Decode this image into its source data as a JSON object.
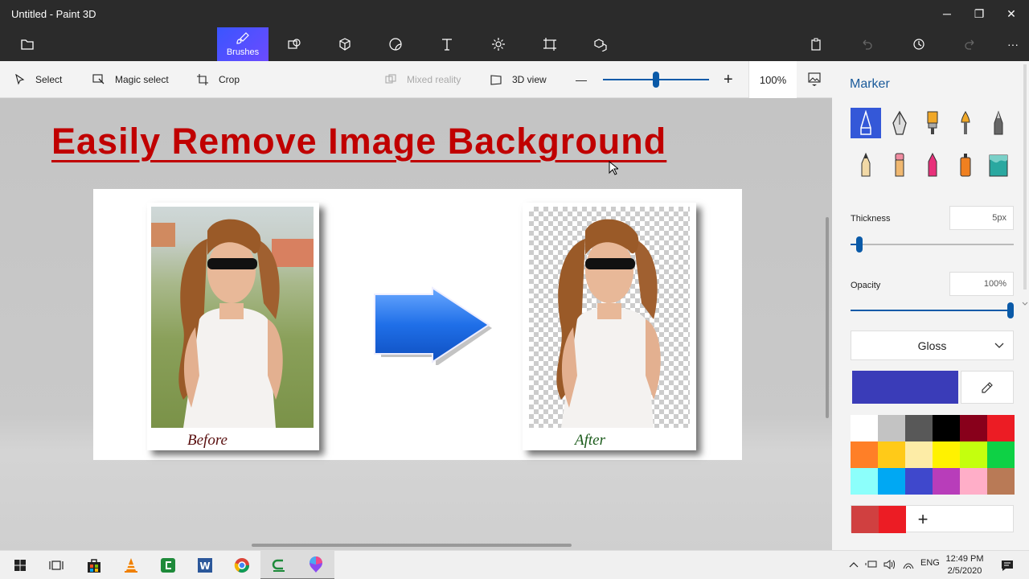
{
  "window": {
    "title": "Untitled - Paint 3D",
    "minimize": "─",
    "maximize": "❐",
    "close": "✕"
  },
  "toolbar": {
    "tools": [
      {
        "name": "brushes",
        "label": "Brushes",
        "active": true
      },
      {
        "name": "2d-shapes",
        "label": "",
        "active": false
      },
      {
        "name": "3d-shapes",
        "label": "",
        "active": false
      },
      {
        "name": "stickers",
        "label": "",
        "active": false
      },
      {
        "name": "text",
        "label": "",
        "active": false
      },
      {
        "name": "effects",
        "label": "",
        "active": false
      },
      {
        "name": "canvas",
        "label": "",
        "active": false
      },
      {
        "name": "3d-library",
        "label": "",
        "active": false
      }
    ],
    "more": "···"
  },
  "subtoolbar": {
    "select": "Select",
    "magic_select": "Magic select",
    "crop": "Crop",
    "mixed_reality": "Mixed reality",
    "view_3d": "3D view",
    "zoom_out": "—",
    "zoom_in": "+",
    "zoom_value": "100%",
    "zoom_level": 0.5
  },
  "canvas": {
    "headline": "Easily Remove Image Background",
    "before_caption": "Before",
    "after_caption": "After"
  },
  "panel": {
    "title": "Marker",
    "thickness_label": "Thickness",
    "thickness_value": "5px",
    "thickness_level": 0.05,
    "opacity_label": "Opacity",
    "opacity_value": "100%",
    "opacity_level": 1.0,
    "finish": "Gloss",
    "current_color": "#3a3cb8",
    "palette": [
      "#ffffff",
      "#c3c3c3",
      "#585858",
      "#000000",
      "#88001b",
      "#ec1c24",
      "#ff7f27",
      "#ffca18",
      "#fdeca6",
      "#fff200",
      "#c4ff0e",
      "#0ed145",
      "#8cfffb",
      "#00a8f3",
      "#3f48cc",
      "#b83dba",
      "#ffaec8",
      "#b97a56"
    ],
    "custom_colors": [
      "#d04040",
      "#ec1c24"
    ],
    "add_color": "+"
  },
  "taskbar": {
    "apps": [
      "start",
      "task-view",
      "store",
      "vlc",
      "camtasia",
      "word",
      "chrome",
      "camtasia-recorder",
      "paint-3d"
    ],
    "language": "ENG",
    "time": "12:49 PM",
    "date": "2/5/2020"
  }
}
